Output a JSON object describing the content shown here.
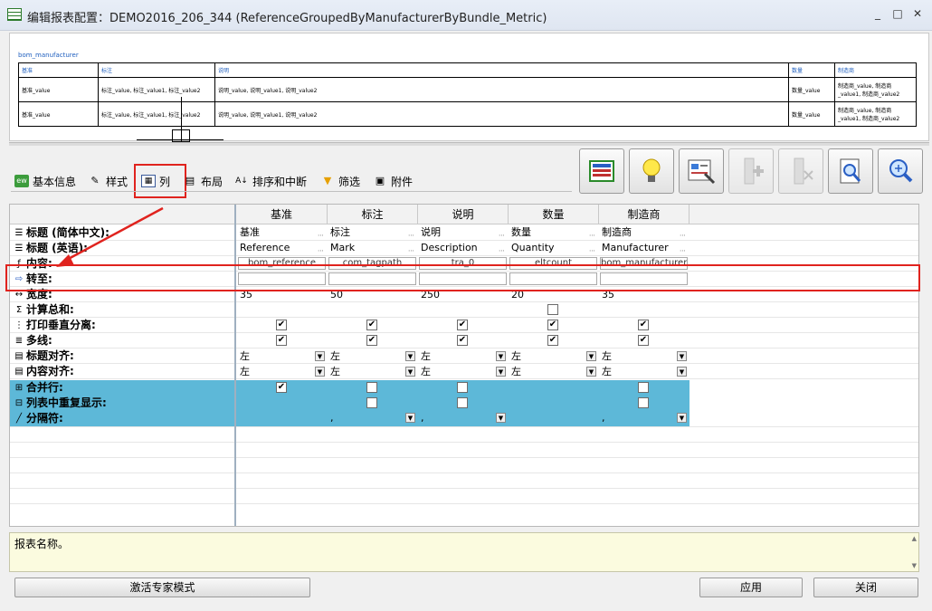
{
  "window": {
    "title": "编辑报表配置：DEMO2016_206_344 (ReferenceGroupedByManufacturerByBundle_Metric)",
    "controls": [
      "_",
      "□",
      "✕"
    ]
  },
  "preview": {
    "link": "bom_manufacturer",
    "headers": [
      "基准",
      "标注",
      "说明",
      "数量",
      "制造商"
    ],
    "rows": [
      [
        "基准_value",
        "标注_value, 标注_value1, 标注_value2",
        "说明_value, 说明_value1, 说明_value2",
        "数量_value",
        "制造商_value, 制造商_value1, 制造商_value2"
      ],
      [
        "基准_value",
        "标注_value, 标注_value1, 标注_value2",
        "说明_value, 说明_value1, 说明_value2",
        "数量_value",
        "制造商_value, 制造商_value1, 制造商_value2"
      ]
    ]
  },
  "tabs": [
    {
      "label": "基本信息",
      "icon": "ew-icon"
    },
    {
      "label": "样式",
      "icon": "brush-icon"
    },
    {
      "label": "列",
      "icon": "table-icon"
    },
    {
      "label": "布局",
      "icon": "layout-icon"
    },
    {
      "label": "排序和中断",
      "icon": "sort-az-icon"
    },
    {
      "label": "筛选",
      "icon": "filter-icon"
    },
    {
      "label": "附件",
      "icon": "attachment-icon"
    }
  ],
  "toolbar_icons": [
    "table-view-icon",
    "lightbulb-icon",
    "properties-icon",
    "insert-column-icon",
    "delete-column-icon",
    "preview-icon",
    "zoom-icon"
  ],
  "grid": {
    "columns": [
      "基准",
      "标注",
      "说明",
      "数量",
      "制造商"
    ],
    "row_labels": {
      "title_cn": "标题 (简体中文):",
      "title_en": "标题 (英语):",
      "content": "内容:",
      "goto": "转至:",
      "width": "宽度:",
      "sum": "计算总和:",
      "print_split": "打印垂直分离:",
      "multiline": "多线:",
      "title_align": "标题对齐:",
      "content_align": "内容对齐:",
      "merge": "合并行:",
      "repeat": "列表中重复显示:",
      "separator": "分隔符:"
    },
    "title_cn": [
      "基准",
      "标注",
      "说明",
      "数量",
      "制造商"
    ],
    "title_en": [
      "Reference",
      "Mark",
      "Description",
      "Quantity",
      "Manufacturer"
    ],
    "content": [
      "bom_reference",
      "com_tagpath",
      "tra_0",
      "eltcount",
      "bom_manufacturer"
    ],
    "goto": [
      "",
      "",
      "",
      "",
      ""
    ],
    "width": [
      "35",
      "50",
      "250",
      "20",
      "35"
    ],
    "sum": [
      null,
      null,
      null,
      false,
      null
    ],
    "print_split": [
      true,
      true,
      true,
      true,
      true
    ],
    "multiline": [
      true,
      true,
      true,
      true,
      true
    ],
    "title_align": [
      "左",
      "左",
      "左",
      "左",
      "左"
    ],
    "content_align": [
      "左",
      "左",
      "左",
      "左",
      "左"
    ],
    "merge": [
      true,
      false,
      false,
      null,
      false
    ],
    "repeat": [
      null,
      false,
      false,
      null,
      false
    ],
    "separator": [
      "",
      ",",
      ",",
      "",
      ","
    ]
  },
  "report_name_label": "报表名称。",
  "buttons": {
    "expert_mode": "激活专家模式",
    "apply": "应用",
    "close": "关闭"
  },
  "colors": {
    "highlight": "#e0231e",
    "blue_row": "#5db8d8",
    "footer_bg": "#fbfbdf"
  }
}
